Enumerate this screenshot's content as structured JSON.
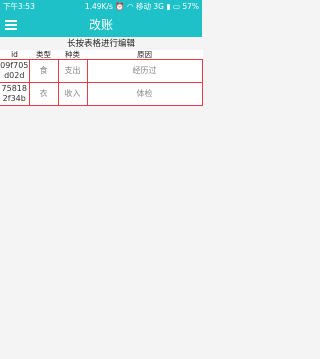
{
  "status_bar": {
    "time": "下午3:53",
    "net_speed": "1.49K/s",
    "carrier": "移动 3G",
    "battery": "57%"
  },
  "app_bar": {
    "title": "改账"
  },
  "hint": "长按表格进行编辑",
  "table": {
    "headers": [
      "id",
      "类型",
      "种类",
      "原因"
    ],
    "rows": [
      {
        "id_line1": "09f705",
        "id_line2": "d02d",
        "type": "食",
        "kind": "支出",
        "reason": "经历过"
      },
      {
        "id_line1": "75818",
        "id_line2": "2f34b",
        "type": "衣",
        "kind": "收入",
        "reason": "体检"
      }
    ]
  },
  "colors": {
    "accent": "#1fc1c8",
    "cell_border": "#e83a4a",
    "background": "#f4f4f4"
  }
}
